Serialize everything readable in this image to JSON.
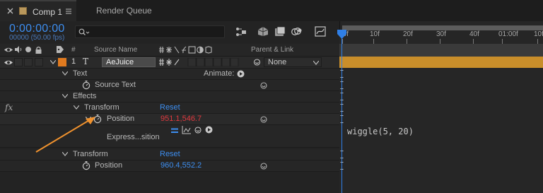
{
  "tabs": [
    {
      "label": "Comp 1",
      "active": true
    },
    {
      "label": "Render Queue",
      "active": false
    }
  ],
  "timecode": {
    "value": "0:00:00:00",
    "frame_info": "00000 (50.00 fps)"
  },
  "search": {
    "placeholder": ""
  },
  "columns": {
    "number": "#",
    "source_name": "Source Name",
    "parent_link": "Parent & Link"
  },
  "layer": {
    "number": "1",
    "type_glyph": "T",
    "name": "AeJuice",
    "parent": "None"
  },
  "tree": {
    "text_group": "Text",
    "animate_label": "Animate:",
    "source_text": "Source Text",
    "effects_group": "Effects",
    "fx_label": "fx",
    "transform_effect": "Transform",
    "reset_1": "Reset",
    "position_1": "Position",
    "position_1_value": "951.1,546.7",
    "expression_label": "Express...sition",
    "transform_layer": "Transform",
    "reset_2": "Reset",
    "position_2": "Position",
    "position_2_value": "960.4,552.2"
  },
  "timeline": {
    "ruler_labels": [
      "00f",
      "10f",
      "20f",
      "30f",
      "40f",
      "01:00f",
      "10f"
    ],
    "expression_text": "wiggle(5, 20)"
  },
  "colors": {
    "accent_blue": "#3d8ef0",
    "value_red": "#e0393f",
    "layer_bar": "#c98e2a",
    "label_orange": "#e07a1f",
    "arrow_orange": "#f0922e"
  }
}
